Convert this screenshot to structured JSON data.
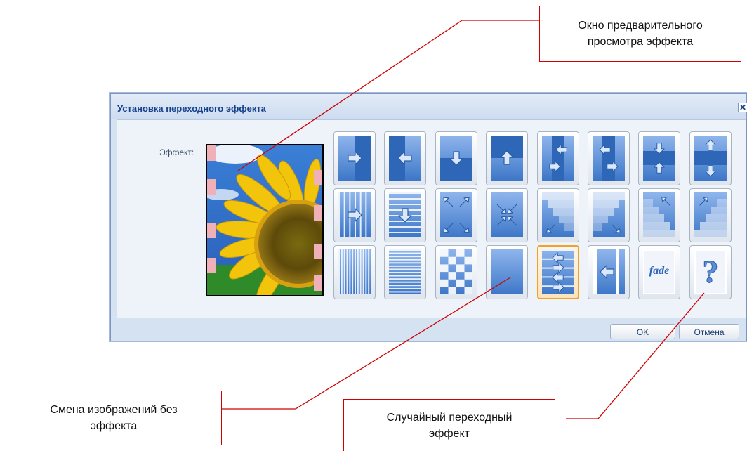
{
  "callouts": {
    "preview": [
      "Окно предварительного",
      "просмотра эффекта"
    ],
    "no_effect": [
      "Смена изображений без",
      "эффекта"
    ],
    "random": [
      "Случайный переходный",
      "эффект"
    ]
  },
  "dialog": {
    "title": "Установка переходного эффекта",
    "close_glyph": "✕",
    "effect_label": "Эффект:",
    "ok_label": "OK",
    "cancel_label": "Отмена",
    "fade_label": "fade",
    "random_label": "?"
  },
  "effects": [
    {
      "name": "wipe-right-icon"
    },
    {
      "name": "wipe-left-icon"
    },
    {
      "name": "wipe-down-icon"
    },
    {
      "name": "wipe-up-icon"
    },
    {
      "name": "split-horizontal-in-icon"
    },
    {
      "name": "split-horizontal-out-icon"
    },
    {
      "name": "split-vertical-in-icon"
    },
    {
      "name": "split-vertical-out-icon"
    },
    {
      "name": "blinds-right-icon"
    },
    {
      "name": "blinds-down-icon"
    },
    {
      "name": "box-out-icon"
    },
    {
      "name": "box-in-icon"
    },
    {
      "name": "stairs-down-left-icon"
    },
    {
      "name": "stairs-down-right-icon"
    },
    {
      "name": "stairs-up-left-icon"
    },
    {
      "name": "stairs-up-right-icon"
    },
    {
      "name": "vertical-stripes-icon"
    },
    {
      "name": "horizontal-stripes-icon"
    },
    {
      "name": "checkerboard-icon"
    },
    {
      "name": "no-effect-icon"
    },
    {
      "name": "interlace-icon"
    },
    {
      "name": "push-left-icon"
    },
    {
      "name": "fade-icon"
    },
    {
      "name": "random-effect-icon"
    }
  ],
  "selected_effect": "interlace-icon",
  "colors": {
    "callout_border": "#d00000",
    "title_text": "#15428b",
    "tile_blue_light": "#8fb5ec",
    "tile_blue_dark": "#3d77c8",
    "selected_border": "#f0a030"
  }
}
